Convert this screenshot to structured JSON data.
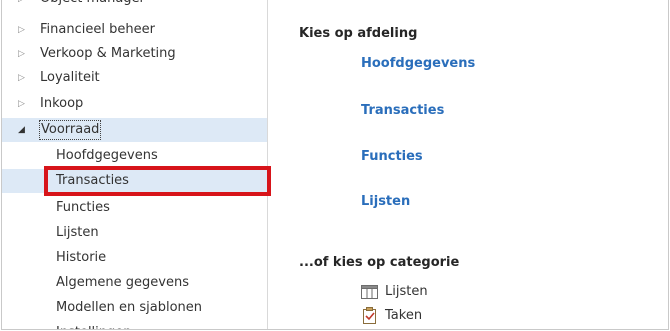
{
  "sidebar": {
    "items": [
      {
        "label": "Object manager",
        "arrow": "▷"
      },
      {
        "label": "Financieel beheer",
        "arrow": "▷"
      },
      {
        "label": "Verkoop & Marketing",
        "arrow": "▷"
      },
      {
        "label": "Loyaliteit",
        "arrow": "▷"
      },
      {
        "label": "Inkoop",
        "arrow": "▷"
      },
      {
        "label": "Voorraad",
        "arrow": "◢"
      }
    ],
    "children": [
      {
        "label": "Hoofdgegevens"
      },
      {
        "label": "Transacties"
      },
      {
        "label": "Functies"
      },
      {
        "label": "Lijsten"
      },
      {
        "label": "Historie"
      },
      {
        "label": "Algemene gegevens"
      },
      {
        "label": "Modellen en sjablonen"
      },
      {
        "label": "Instellingen"
      }
    ]
  },
  "main": {
    "department_heading": "Kies op afdeling",
    "department_links": [
      "Hoofdgegevens",
      "Transacties",
      "Functies",
      "Lijsten"
    ],
    "category_heading": "...of kies op categorie",
    "categories": [
      {
        "label": "Lijsten",
        "icon": "table-icon"
      },
      {
        "label": "Taken",
        "icon": "clipboard-check-icon"
      }
    ]
  },
  "colors": {
    "link": "#2a6ebb",
    "selected_bg": "#dde9f6",
    "highlight_border": "#d7141a"
  }
}
